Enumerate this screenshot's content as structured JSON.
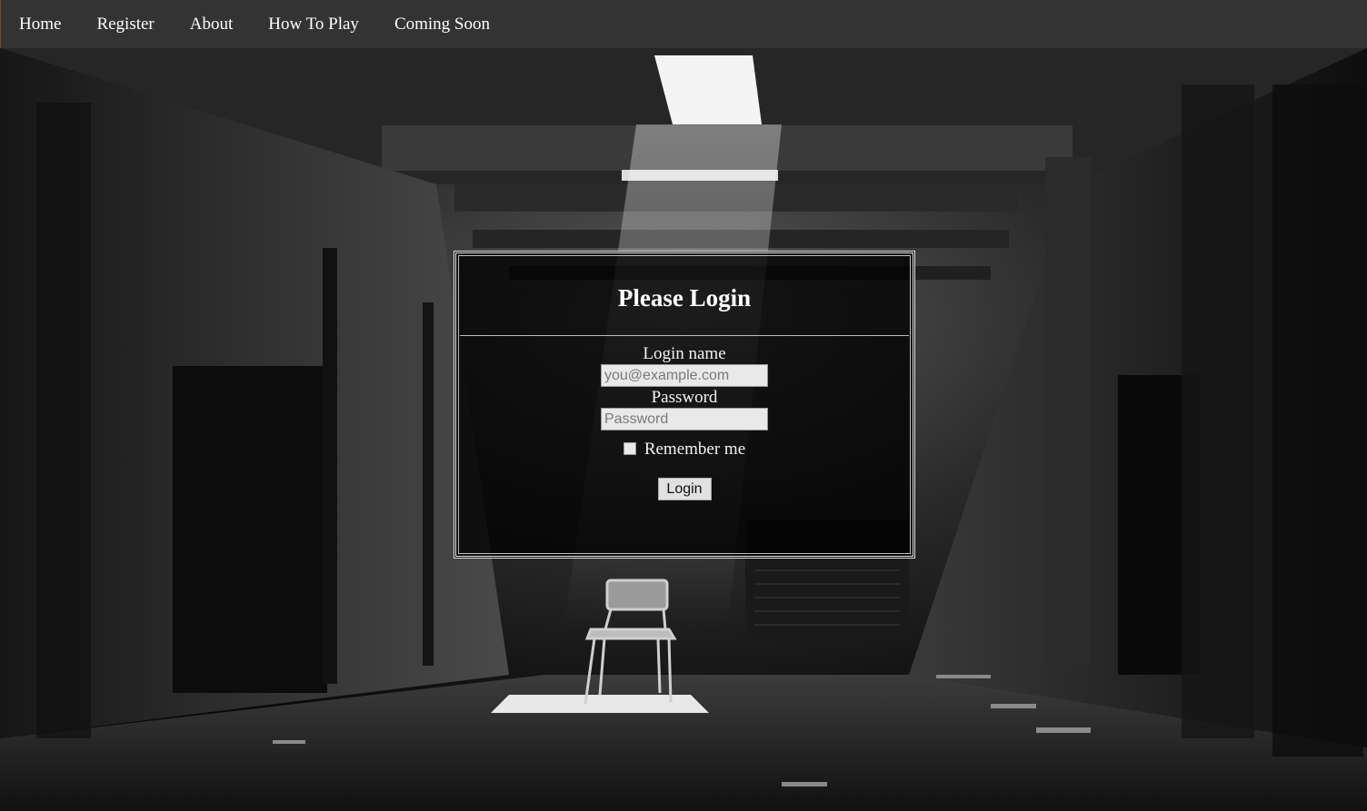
{
  "nav": {
    "items": [
      {
        "label": "Home"
      },
      {
        "label": "Register"
      },
      {
        "label": "About"
      },
      {
        "label": "How To Play"
      },
      {
        "label": "Coming Soon"
      }
    ]
  },
  "login": {
    "title": "Please Login",
    "login_name_label": "Login name",
    "login_name_placeholder": "you@example.com",
    "password_label": "Password",
    "password_placeholder": "Password",
    "remember_label": "Remember me",
    "remember_checked": false,
    "button_label": "Login"
  },
  "background": {
    "description_icon": "abandoned-warehouse-photo"
  },
  "colors": {
    "navbar": "#333333",
    "nav_text": "#ffffff",
    "panel_border": "#e6e6e6"
  }
}
